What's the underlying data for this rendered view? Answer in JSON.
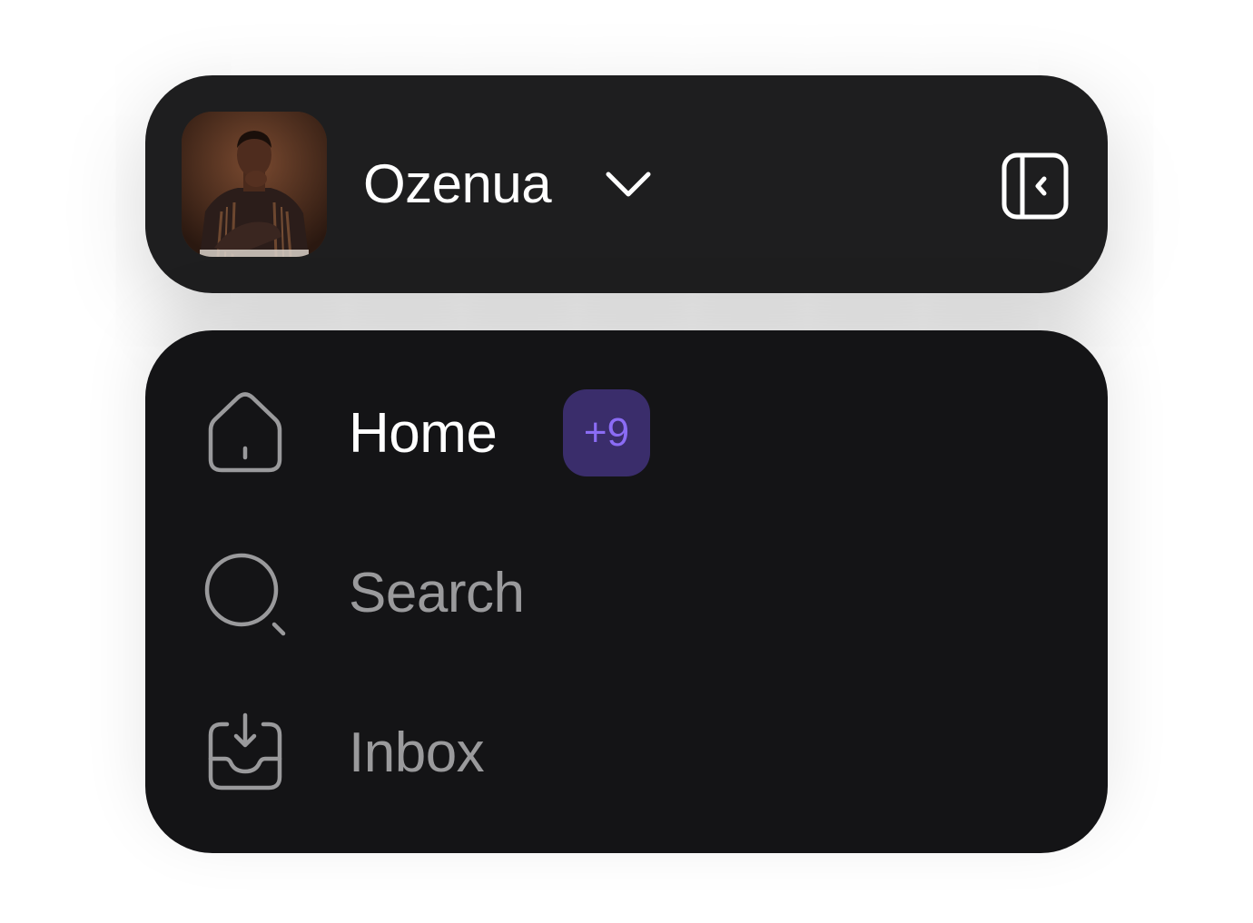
{
  "header": {
    "user_name": "Ozenua",
    "avatar_alt": "profile photo",
    "dropdown_icon": "chevron-down-icon",
    "collapse_icon": "sidebar-collapse-icon"
  },
  "nav": {
    "items": [
      {
        "label": "Home",
        "icon": "home-icon",
        "active": true,
        "badge": "+9"
      },
      {
        "label": "Search",
        "icon": "search-icon",
        "active": false
      },
      {
        "label": "Inbox",
        "icon": "inbox-icon",
        "active": false
      }
    ]
  },
  "colors": {
    "header_bg": "#1e1e1f",
    "nav_bg": "#141416",
    "active_text": "#ffffff",
    "muted_text": "#9a9a9c",
    "badge_bg": "#3a2d6b",
    "badge_text": "#8b6cf5"
  }
}
